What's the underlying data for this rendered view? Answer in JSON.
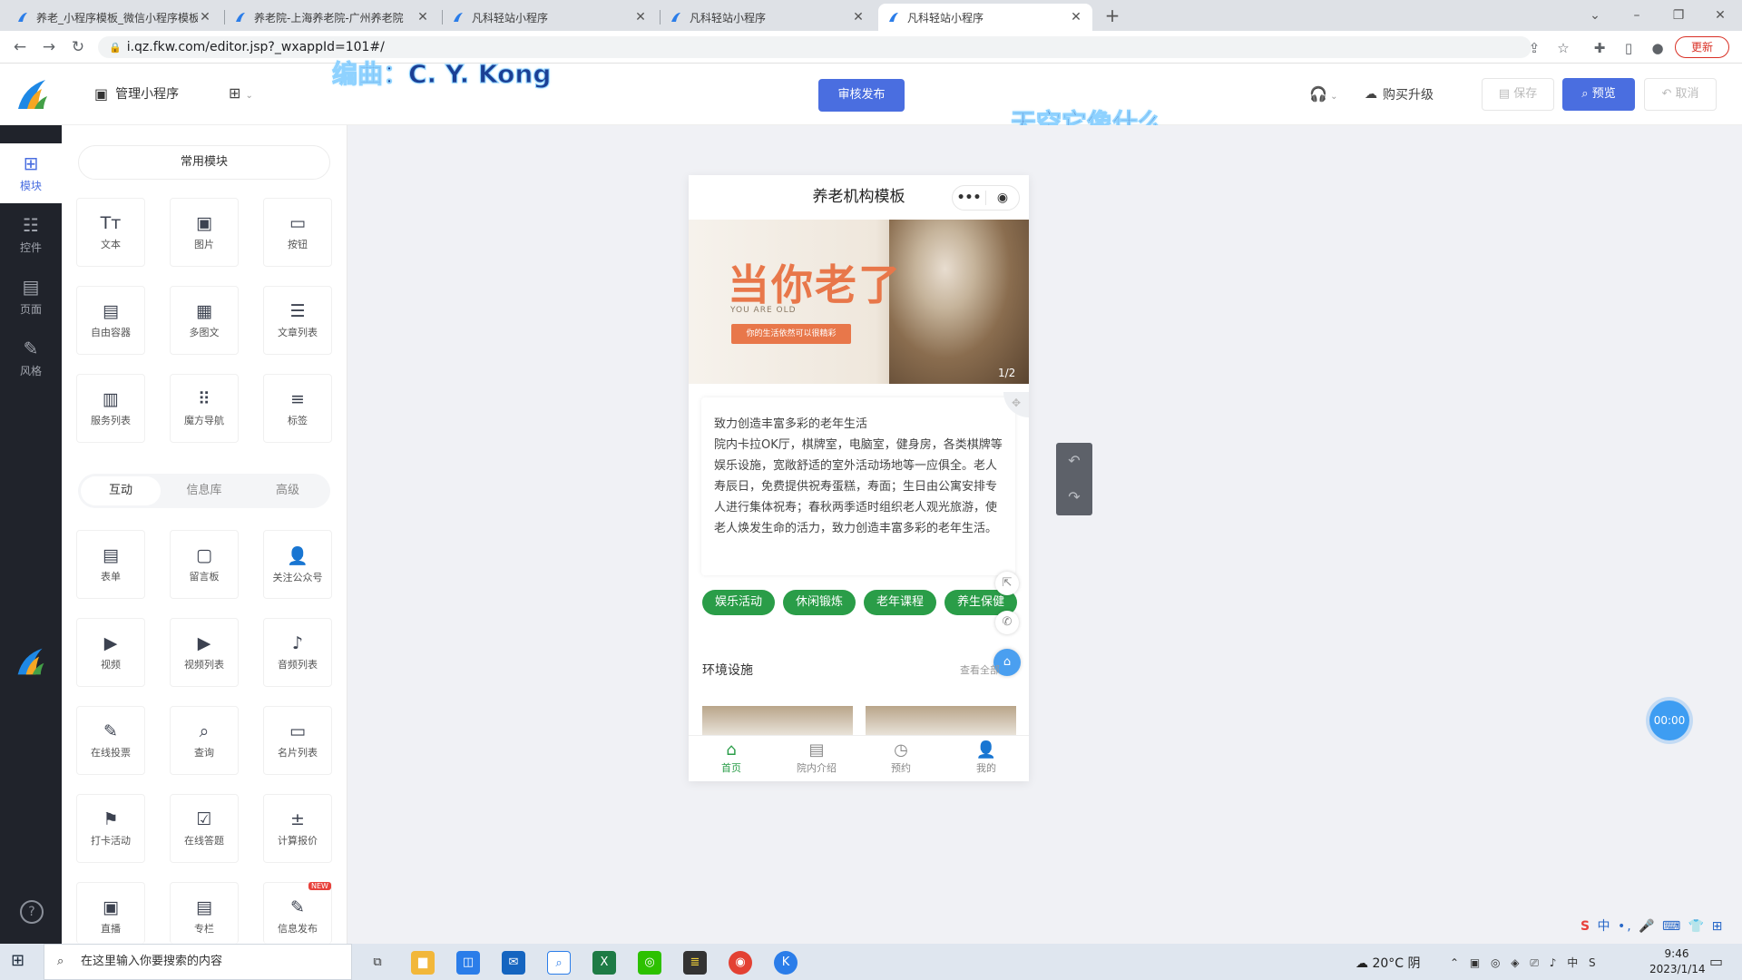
{
  "browser": {
    "tabs": [
      {
        "title": "养老_小程序模板_微信小程序模板",
        "active": false
      },
      {
        "title": "养老院-上海养老院-广州养老院",
        "active": false
      },
      {
        "title": "凡科轻站小程序",
        "active": false
      },
      {
        "title": "凡科轻站小程序",
        "active": false
      },
      {
        "title": "凡科轻站小程序",
        "active": true
      }
    ],
    "url": "i.qz.fkw.com/editor.jsp?_wxappId=101#/",
    "update_label": "更新"
  },
  "header": {
    "manage_label": "管理小程序",
    "audit_label": "审核发布",
    "buy_label": "购买升级",
    "save_label": "保存",
    "preview_label": "预览",
    "cancel_label": "取消"
  },
  "overlay": {
    "credit": "编曲：C. Y.  Kong",
    "lyric": "天空它像什么"
  },
  "rail": [
    {
      "label": "模块",
      "icon": "plus-square-icon",
      "active": true
    },
    {
      "label": "控件",
      "icon": "sliders-icon",
      "active": false
    },
    {
      "label": "页面",
      "icon": "pages-icon",
      "active": false
    },
    {
      "label": "风格",
      "icon": "brush-icon",
      "active": false
    }
  ],
  "modules": {
    "common_header": "常用模块",
    "common": [
      {
        "label": "文本",
        "icon": "Tт"
      },
      {
        "label": "图片",
        "icon": "▣"
      },
      {
        "label": "按钮",
        "icon": "▭"
      },
      {
        "label": "自由容器",
        "icon": "▤"
      },
      {
        "label": "多图文",
        "icon": "▦"
      },
      {
        "label": "文章列表",
        "icon": "☰"
      },
      {
        "label": "服务列表",
        "icon": "▥"
      },
      {
        "label": "魔方导航",
        "icon": "⠿"
      },
      {
        "label": "标签",
        "icon": "≡"
      }
    ],
    "subtabs": [
      "互动",
      "信息库",
      "高级"
    ],
    "interactive": [
      {
        "label": "表单",
        "icon": "▤"
      },
      {
        "label": "留言板",
        "icon": "▢"
      },
      {
        "label": "关注公众号",
        "icon": "👤"
      },
      {
        "label": "视频",
        "icon": "▶"
      },
      {
        "label": "视频列表",
        "icon": "▶"
      },
      {
        "label": "音频列表",
        "icon": "♪"
      },
      {
        "label": "在线投票",
        "icon": "✎"
      },
      {
        "label": "查询",
        "icon": "⌕"
      },
      {
        "label": "名片列表",
        "icon": "▭"
      },
      {
        "label": "打卡活动",
        "icon": "⚑"
      },
      {
        "label": "在线答题",
        "icon": "☑"
      },
      {
        "label": "计算报价",
        "icon": "±"
      },
      {
        "label": "直播",
        "icon": "▣"
      },
      {
        "label": "专栏",
        "icon": "▤"
      },
      {
        "label": "信息发布",
        "icon": "✎"
      }
    ],
    "new_badge": "NEW"
  },
  "phone": {
    "title": "养老机构模板",
    "banner": {
      "headline": "当你老了",
      "sub": "YOU ARE OLD",
      "tag": "你的生活依然可以很精彩",
      "page": "1/2"
    },
    "intro_title": "致力创造丰富多彩的老年生活",
    "intro_body": "院内卡拉OK厅，棋牌室，电脑室，健身房，各类棋牌等娱乐设施，宽敞舒适的室外活动场地等一应俱全。老人寿辰日，免费提供祝寿蛋糕，寿面；生日由公寓安排专人进行集体祝寿；春秋两季适时组织老人观光旅游，使老人焕发生命的活力，致力创造丰富多彩的老年生活。",
    "tags": [
      "娱乐活动",
      "休闲锻炼",
      "老年课程",
      "养生保健"
    ],
    "section_title": "环境设施",
    "section_more": "查看全部",
    "nav": [
      {
        "label": "首页",
        "icon": "⌂",
        "active": true
      },
      {
        "label": "院内介绍",
        "icon": "▤",
        "active": false
      },
      {
        "label": "预约",
        "icon": "◷",
        "active": false
      },
      {
        "label": "我的",
        "icon": "👤",
        "active": false
      }
    ]
  },
  "timer": "00:00",
  "taskbar": {
    "search_placeholder": "在这里输入你要搜索的内容",
    "weather": "20°C  阴",
    "time": "9:46",
    "date": "2023/1/14"
  },
  "colors": {
    "accent": "#4a6ee0",
    "green": "#2a9d48",
    "rail": "#20232b"
  }
}
